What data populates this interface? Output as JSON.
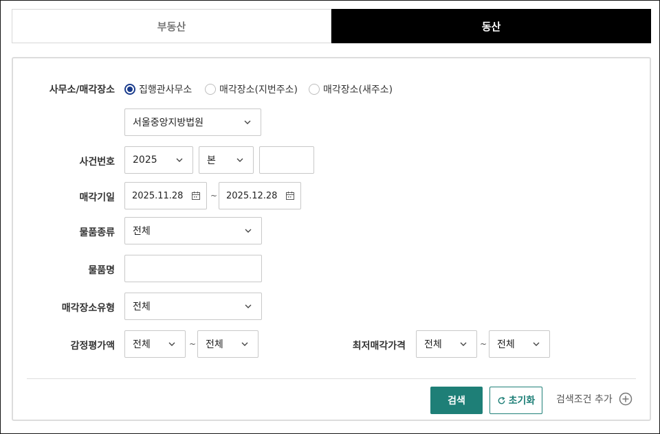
{
  "tabs": {
    "real_estate": "부동산",
    "movable": "동산"
  },
  "form": {
    "office": {
      "label": "사무소/매각장소",
      "options": [
        "집행관사무소",
        "매각장소(지번주소)",
        "매각장소(새주소)"
      ],
      "selected_index": 0,
      "court": "서울중앙지방법원"
    },
    "case_no": {
      "label": "사건번호",
      "year": "2025",
      "type": "본",
      "number": ""
    },
    "sale_date": {
      "label": "매각기일",
      "from": "2025.11.28",
      "to": "2025.12.28",
      "sep": "~"
    },
    "item_type": {
      "label": "물품종류",
      "value": "전체"
    },
    "item_name": {
      "label": "물품명",
      "value": ""
    },
    "place_type": {
      "label": "매각장소유형",
      "value": "전체"
    },
    "appraisal": {
      "label": "감정평가액",
      "from": "전체",
      "to": "전체",
      "sep": "~"
    },
    "min_price": {
      "label": "최저매각가격",
      "from": "전체",
      "to": "전체",
      "sep": "~"
    }
  },
  "actions": {
    "search": "검색",
    "reset": "초기화",
    "add_condition": "검색조건 추가"
  },
  "colors": {
    "accent": "#1e7f77",
    "radio": "#1a3c8c",
    "active_tab": "#000000"
  },
  "icons": [
    "chevron-down-icon",
    "calendar-icon",
    "refresh-icon",
    "plus-circle-icon"
  ]
}
